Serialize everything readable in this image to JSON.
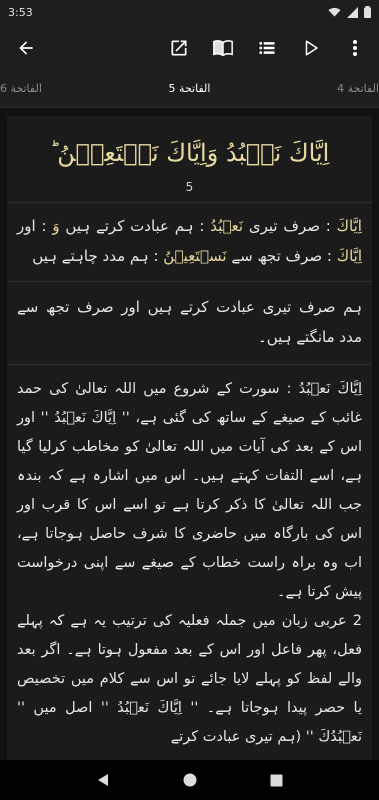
{
  "status": {
    "time": "3:53",
    "icons": [
      "wifi-icon",
      "signal-icon",
      "battery-icon"
    ]
  },
  "toolbar": {
    "back_icon": "back-arrow-icon",
    "actions": [
      "open-external-icon",
      "book-icon",
      "list-icon",
      "play-icon",
      "more-icon"
    ]
  },
  "tabs": {
    "left": "الفاتحة 6",
    "center": "الفاتحة 5",
    "right": "الفاتحة 4"
  },
  "ayah": {
    "arabic": "اِيَّاكَ نَعۡبُدُ وَاِيَّاكَ نَسۡتَعِيۡنُ ؕ",
    "number": "5"
  },
  "word_by_word": {
    "w1_ar": "اِيَّاكَ",
    "w1_ur": ": صرف تیری",
    "w2_ar": "نَعۡبُدُ",
    "w2_ur": ": ہم عبادت کرتے ہیں",
    "w3_ar": "وَ",
    "w3_ur": ": اور",
    "w4_ar": "اِيَّاكَ",
    "w4_ur": ": صرف تجھ سے",
    "w5_ar": "نَسۡتَعِيۡنُ",
    "w5_ur": ": ہم مدد چاہتے ہیں"
  },
  "translation": "ہم صرف تیری عبادت کرتے ہیں اور صرف تجھ سے مدد مانگتے ہیں۔",
  "tafsir": {
    "p1": "اِيَّاكَ نَعۡبُدُ : سورت کے شروع میں اللہ تعالیٰ کی حمد غائب کے صیغے کے ساتھ کی گئی ہے، '' اِيَّاكَ نَعۡبُدُ '' اور اس کے بعد کی آیات میں اللہ تعالیٰ کو مخاطب کرلیا گیا ہے، اسے التفات کہتے ہیں۔ اس میں اشارہ ہے کہ بندہ جب اللہ تعالیٰ کا ذکر کرتا ہے تو اسے اس کا قرب اور اس کی بارگاہ میں حاضری کا شرف حاصل ہوجاتا ہے، اب وہ براہ راست خطاب کے صیغے سے اپنی درخواست پیش کرتا ہے۔",
    "p2": "2 عربی زبان میں جملہ فعلیہ کی ترتیب یہ ہے کہ پہلے فعل، پھر فاعل اور اس کے بعد مفعول ہوتا ہے۔ اگر بعد والے لفظ کو پہلے لایا جائے تو اس سے کلام میں تخصیص یا حصر پیدا ہوجاتا ہے۔ '' اِيَّاكَ نَعۡبُدُ '' اصل میں '' نَعۡبُدُكَ '' (ہم تیری عبادت کرتے"
  },
  "colors": {
    "accent_text": "#e8d9a0",
    "background": "#111111",
    "card": "#1b1b1b"
  }
}
